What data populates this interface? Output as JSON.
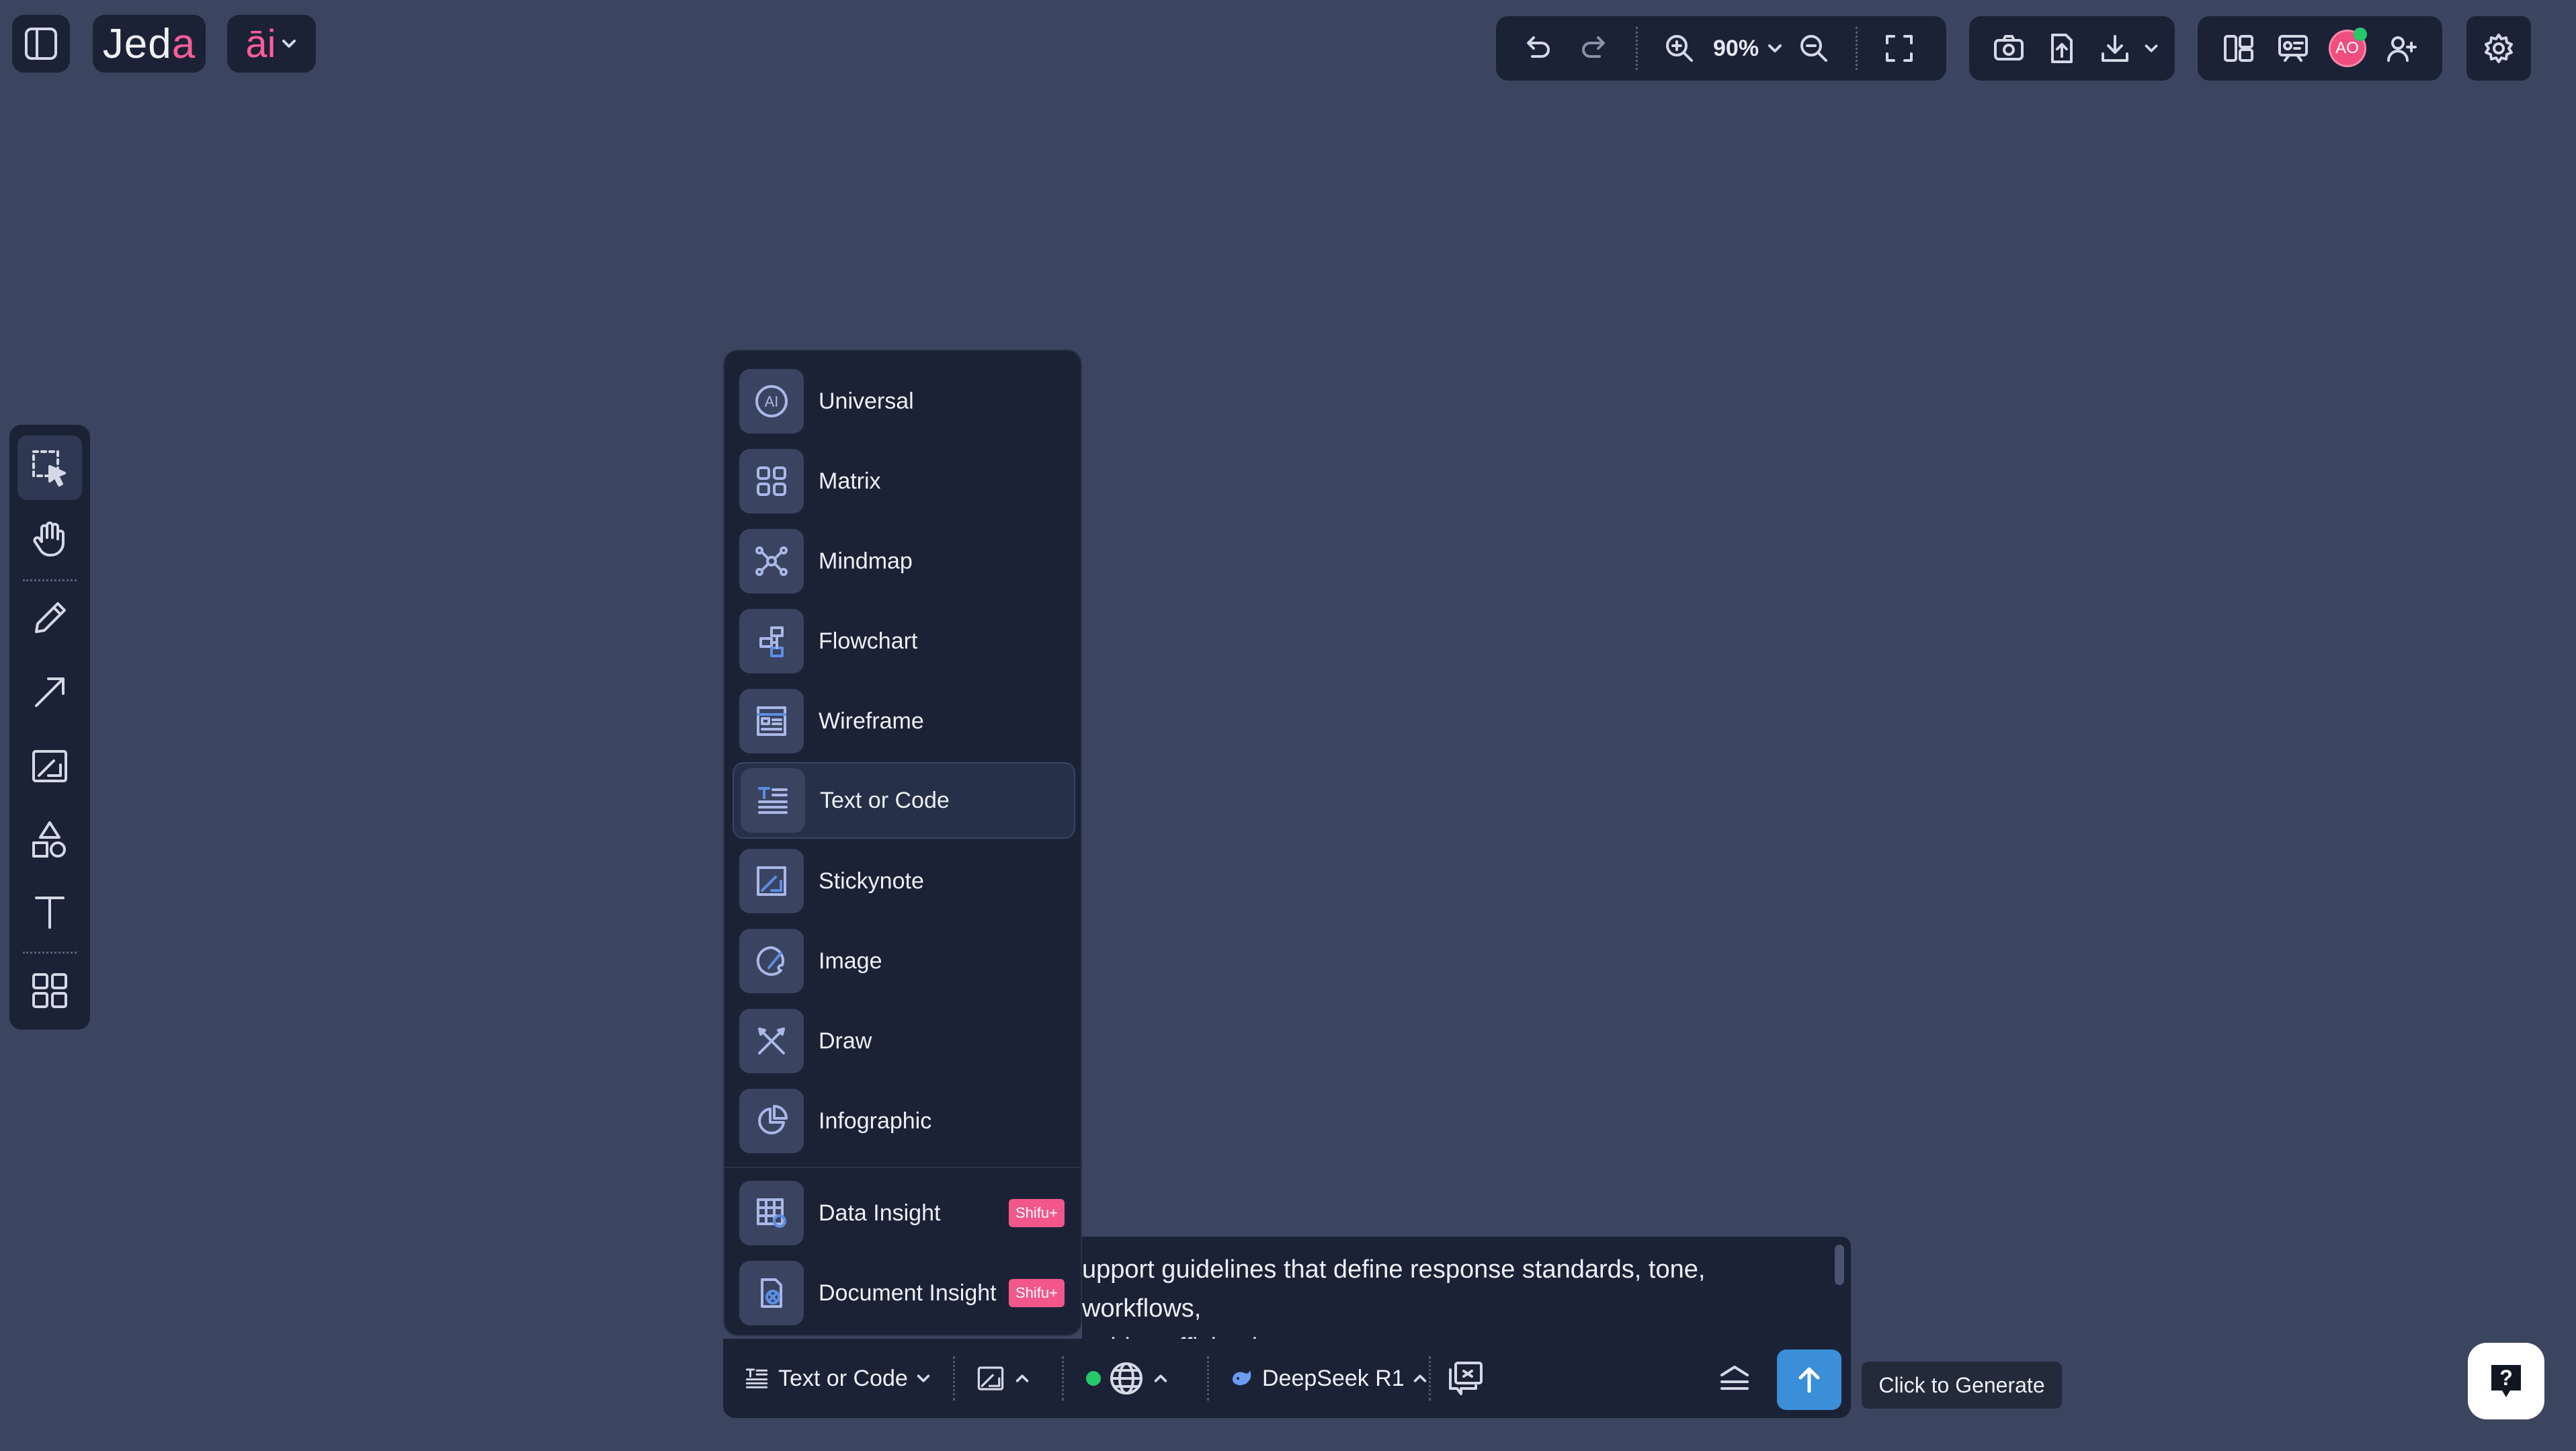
{
  "app": {
    "logo_text": "Jed",
    "logo_accent": "a",
    "ai_label": "āi"
  },
  "toolbar": {
    "zoom_level": "90%"
  },
  "user": {
    "avatar_initials": "AO"
  },
  "mode_menu": {
    "items": [
      {
        "label": "Universal",
        "icon": "ai-icon"
      },
      {
        "label": "Matrix",
        "icon": "grid-icon"
      },
      {
        "label": "Mindmap",
        "icon": "mindmap-icon"
      },
      {
        "label": "Flowchart",
        "icon": "flowchart-icon"
      },
      {
        "label": "Wireframe",
        "icon": "wireframe-icon"
      },
      {
        "label": "Text or Code",
        "icon": "text-code-icon",
        "selected": true
      },
      {
        "label": "Stickynote",
        "icon": "stickynote-icon"
      },
      {
        "label": "Image",
        "icon": "image-icon"
      },
      {
        "label": "Draw",
        "icon": "draw-icon"
      },
      {
        "label": "Infographic",
        "icon": "infographic-icon"
      }
    ],
    "premium_items": [
      {
        "label": "Data Insight",
        "badge": "Shifu+",
        "icon": "data-insight-icon"
      },
      {
        "label": "Document Insight",
        "badge": "Shifu+",
        "icon": "document-insight-icon"
      }
    ]
  },
  "prompt": {
    "text": "upport guidelines that define response standards, tone, workflows,\nquiries efficiently."
  },
  "bottom_bar": {
    "mode_label": "Text or Code",
    "model_label": "DeepSeek R1"
  },
  "tooltip": {
    "text": "Click to Generate"
  },
  "help": {
    "label": "?"
  },
  "colors": {
    "background": "#3b4560",
    "panel": "#1b2236",
    "accent_pink": "#ff5c9a",
    "generate_blue": "#3a8fd8",
    "status_green": "#26c86a",
    "badge_pink": "#f2568a"
  }
}
